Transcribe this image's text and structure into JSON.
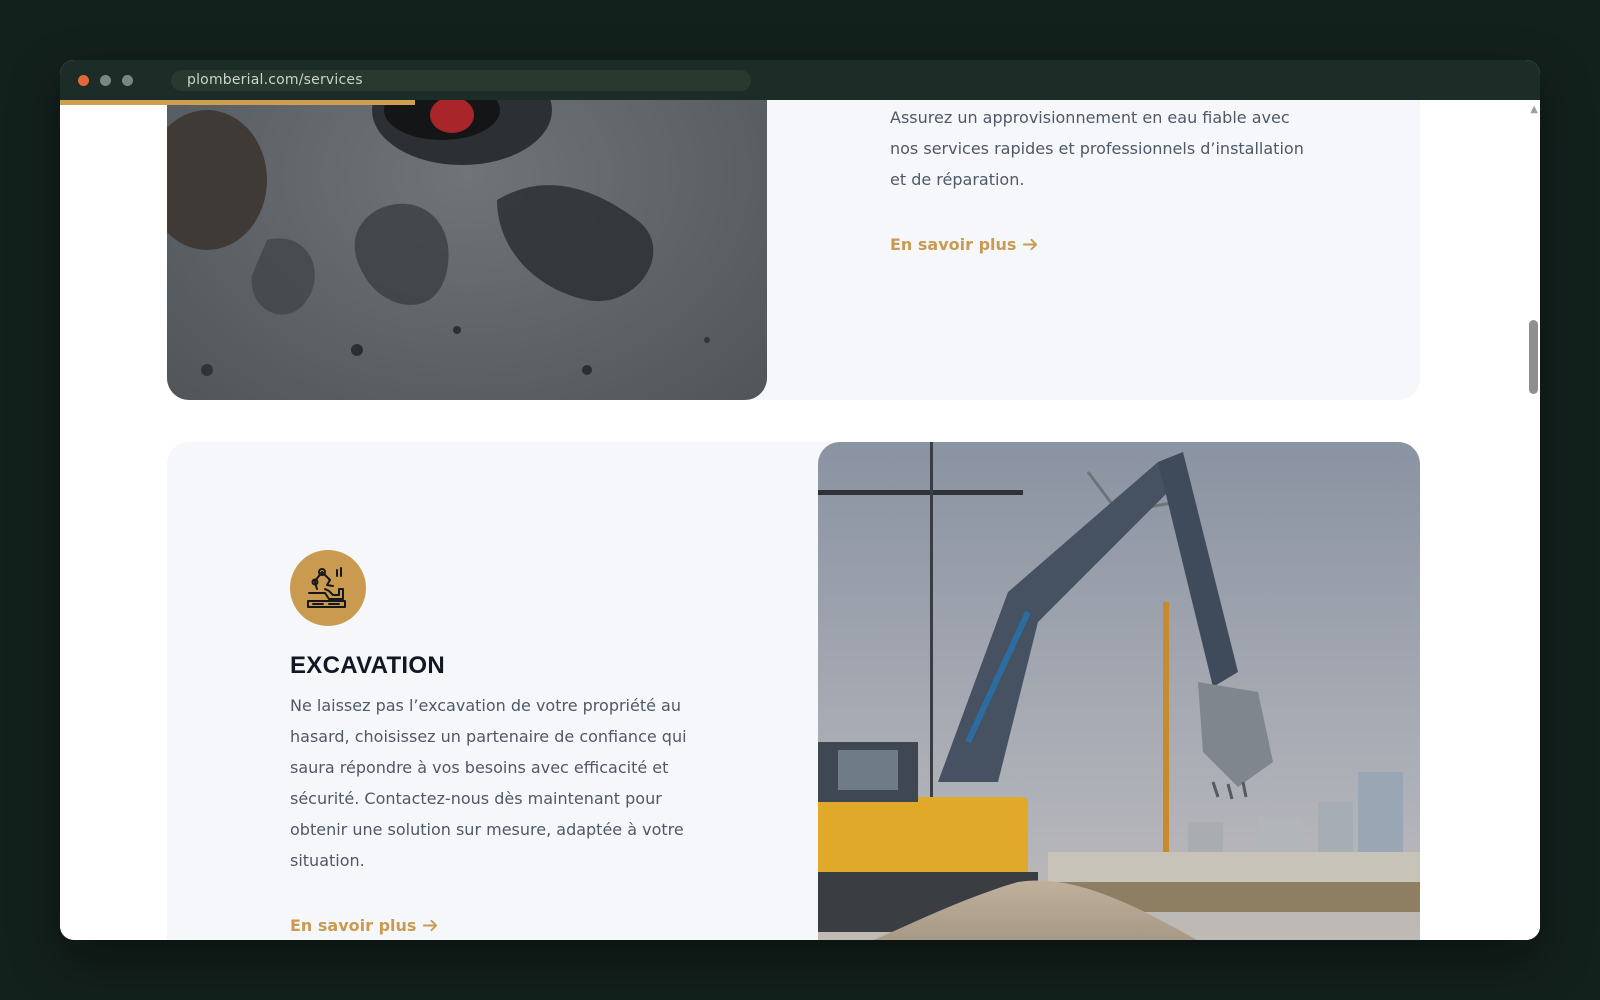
{
  "browser": {
    "url": "plomberial.com/services",
    "scroll_progress_percent": 24
  },
  "services": [
    {
      "description": "Assurez un approvisionnement en eau fiable avec nos services rapides et professionnels d’installation et de réparation.",
      "link_label": "En savoir plus",
      "image": "wet-pavement-manhole-photo"
    },
    {
      "title": "EXCAVATION",
      "icon": "excavator-icon",
      "description": "Ne laissez pas l’excavation de votre propriété au hasard, choisissez un partenaire de confiance qui saura répondre à vos besoins avec efficacité et sécurité. Contactez-nous dès maintenant pour obtenir une solution sur mesure, adaptée à votre situation.",
      "link_label": "En savoir plus",
      "image": "excavator-construction-site-photo"
    }
  ],
  "colors": {
    "accent": "#c99a4f",
    "card_background": "#f6f7fb",
    "title": "#121722",
    "body_text": "#4f5866",
    "chrome": "#1c2c27"
  }
}
